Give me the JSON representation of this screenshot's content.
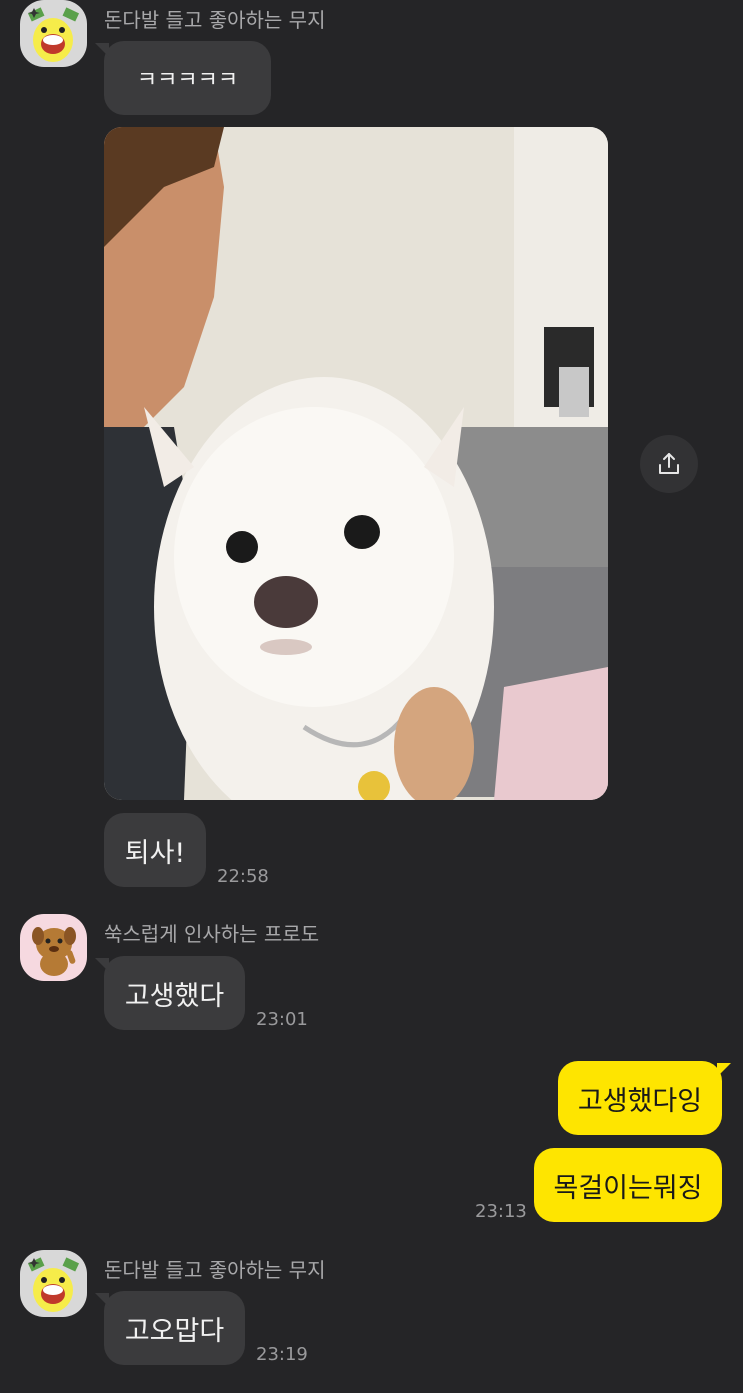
{
  "messages": {
    "group1": {
      "sender": "돈다발 들고 좋아하는 무지",
      "avatar_icon": "muzi-holding-money-icon",
      "text1": "ㅋㅋㅋㅋㅋ",
      "photo_icon": "white-pomeranian-dog-photo",
      "text2": "퇴사!",
      "time": "22:58"
    },
    "group2": {
      "sender": "쑥스럽게 인사하는 프로도",
      "avatar_icon": "frodo-waving-icon",
      "text": "고생했다",
      "time": "23:01"
    },
    "mine": {
      "text1": "고생했다잉",
      "text2": "목걸이는뭐징",
      "time": "23:13"
    },
    "group3": {
      "sender": "돈다발 들고 좋아하는 무지",
      "avatar_icon": "muzi-holding-money-icon",
      "text": "고오맙다",
      "time": "23:19"
    }
  },
  "share_icon": "share-upload-icon",
  "colors": {
    "background": "#252527",
    "bubble_other": "#3b3b3d",
    "bubble_mine": "#fee500"
  }
}
